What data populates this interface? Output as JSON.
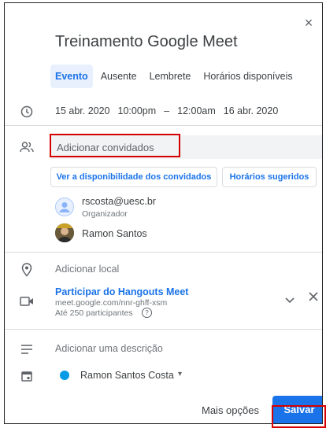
{
  "dialog": {
    "close_label": "×",
    "title": "Treinamento Google Meet",
    "tabs": [
      {
        "label": "Evento",
        "active": true
      },
      {
        "label": "Ausente",
        "active": false
      },
      {
        "label": "Lembrete",
        "active": false
      },
      {
        "label": "Horários disponíveis",
        "active": false
      }
    ],
    "datetime": {
      "start_date": "15 abr. 2020",
      "start_time": "10:00pm",
      "separator": "–",
      "end_time": "12:00am",
      "end_date": "16 abr. 2020"
    },
    "guests": {
      "placeholder": "Adicionar convidados",
      "availability_button": "Ver a disponibilidade dos convidados",
      "suggested_button": "Horários sugeridos",
      "list": [
        {
          "name": "rscosta@uesc.br",
          "role": "Organizador"
        },
        {
          "name": "Ramon Santos",
          "role": ""
        }
      ]
    },
    "location": {
      "placeholder": "Adicionar local"
    },
    "hangouts": {
      "title": "Participar do Hangouts Meet",
      "url": "meet.google.com/nnr-ghff-xsm",
      "limit": "Até 250 participantes",
      "help_icon": "?"
    },
    "description": {
      "placeholder": "Adicionar uma descrição"
    },
    "calendar": {
      "owner": "Ramon Santos Costa",
      "caret": "▾",
      "color": "#039be5"
    },
    "footer": {
      "more_options": "Mais opções",
      "save": "Salvar"
    }
  },
  "colors": {
    "accent": "#1a73e8",
    "highlight_box": "#d50000"
  }
}
